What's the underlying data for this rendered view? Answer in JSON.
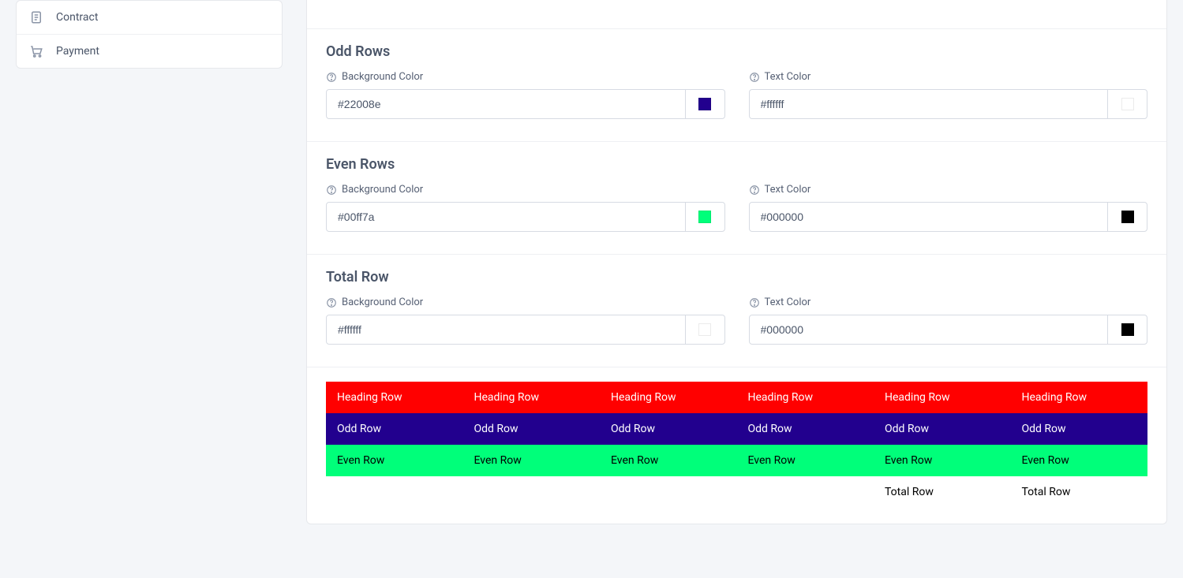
{
  "sidebar": {
    "items": [
      {
        "label": "Contract"
      },
      {
        "label": "Payment"
      }
    ]
  },
  "sections": {
    "odd": {
      "title": "Odd Rows",
      "bg_label": "Background Color",
      "bg_value": "#22008e",
      "text_label": "Text Color",
      "text_value": "#ffffff"
    },
    "even": {
      "title": "Even Rows",
      "bg_label": "Background Color",
      "bg_value": "#00ff7a",
      "text_label": "Text Color",
      "text_value": "#000000"
    },
    "total": {
      "title": "Total Row",
      "bg_label": "Background Color",
      "bg_value": "#ffffff",
      "text_label": "Text Color",
      "text_value": "#000000"
    }
  },
  "preview": {
    "heading_bg": "#ff0000",
    "heading_text": "#ffffff",
    "heading_label": "Heading Row",
    "odd_label": "Odd Row",
    "even_label": "Even Row",
    "total_label": "Total Row"
  }
}
